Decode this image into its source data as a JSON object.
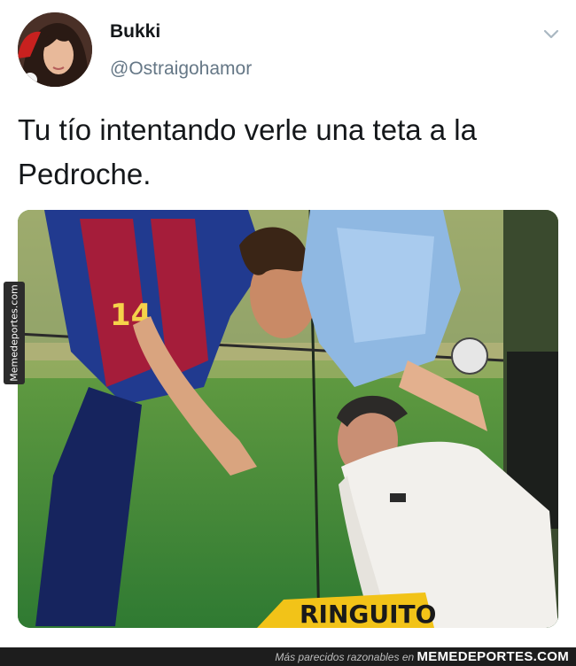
{
  "tweet": {
    "display_name": "Bukki",
    "handle": "@Ostraigohamor",
    "text": "Tu tío intentando verle una teta a la Pedroche.",
    "menu_icon": "chevron-down-icon"
  },
  "media": {
    "banner_text": "RINGUITO",
    "jersey_number": "14"
  },
  "watermarks": {
    "side": "Memedeportes.com",
    "footer_prefix": "Más parecidos razonables en",
    "footer_brand": "MEMEDEPORTES.COM"
  },
  "colors": {
    "text": "#14171a",
    "secondary": "#657786",
    "footer_bg": "#1d1d1d"
  }
}
